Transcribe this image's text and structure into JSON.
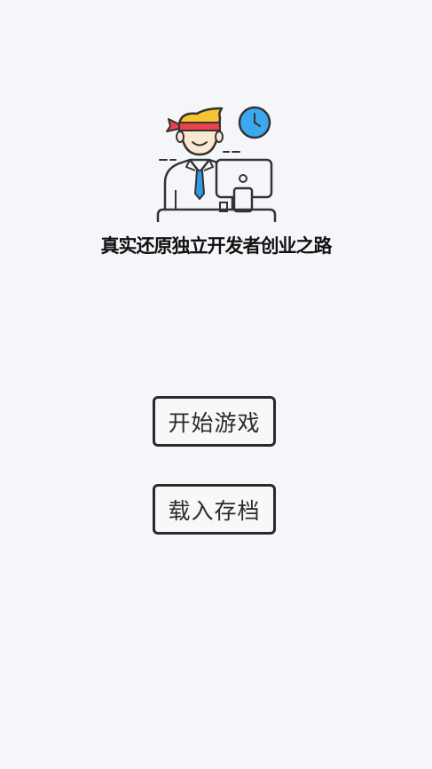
{
  "logo": {
    "icon": "developer-at-computer-icon",
    "colors": {
      "headband": "#e8424a",
      "hair": "#f5c431",
      "tie": "#2f9be6",
      "clock": "#3aa9f0",
      "outline": "#333333"
    }
  },
  "subtitle": "真实还原独立开发者创业之路",
  "menu": {
    "start_label": "开始游戏",
    "load_label": "载入存档"
  }
}
